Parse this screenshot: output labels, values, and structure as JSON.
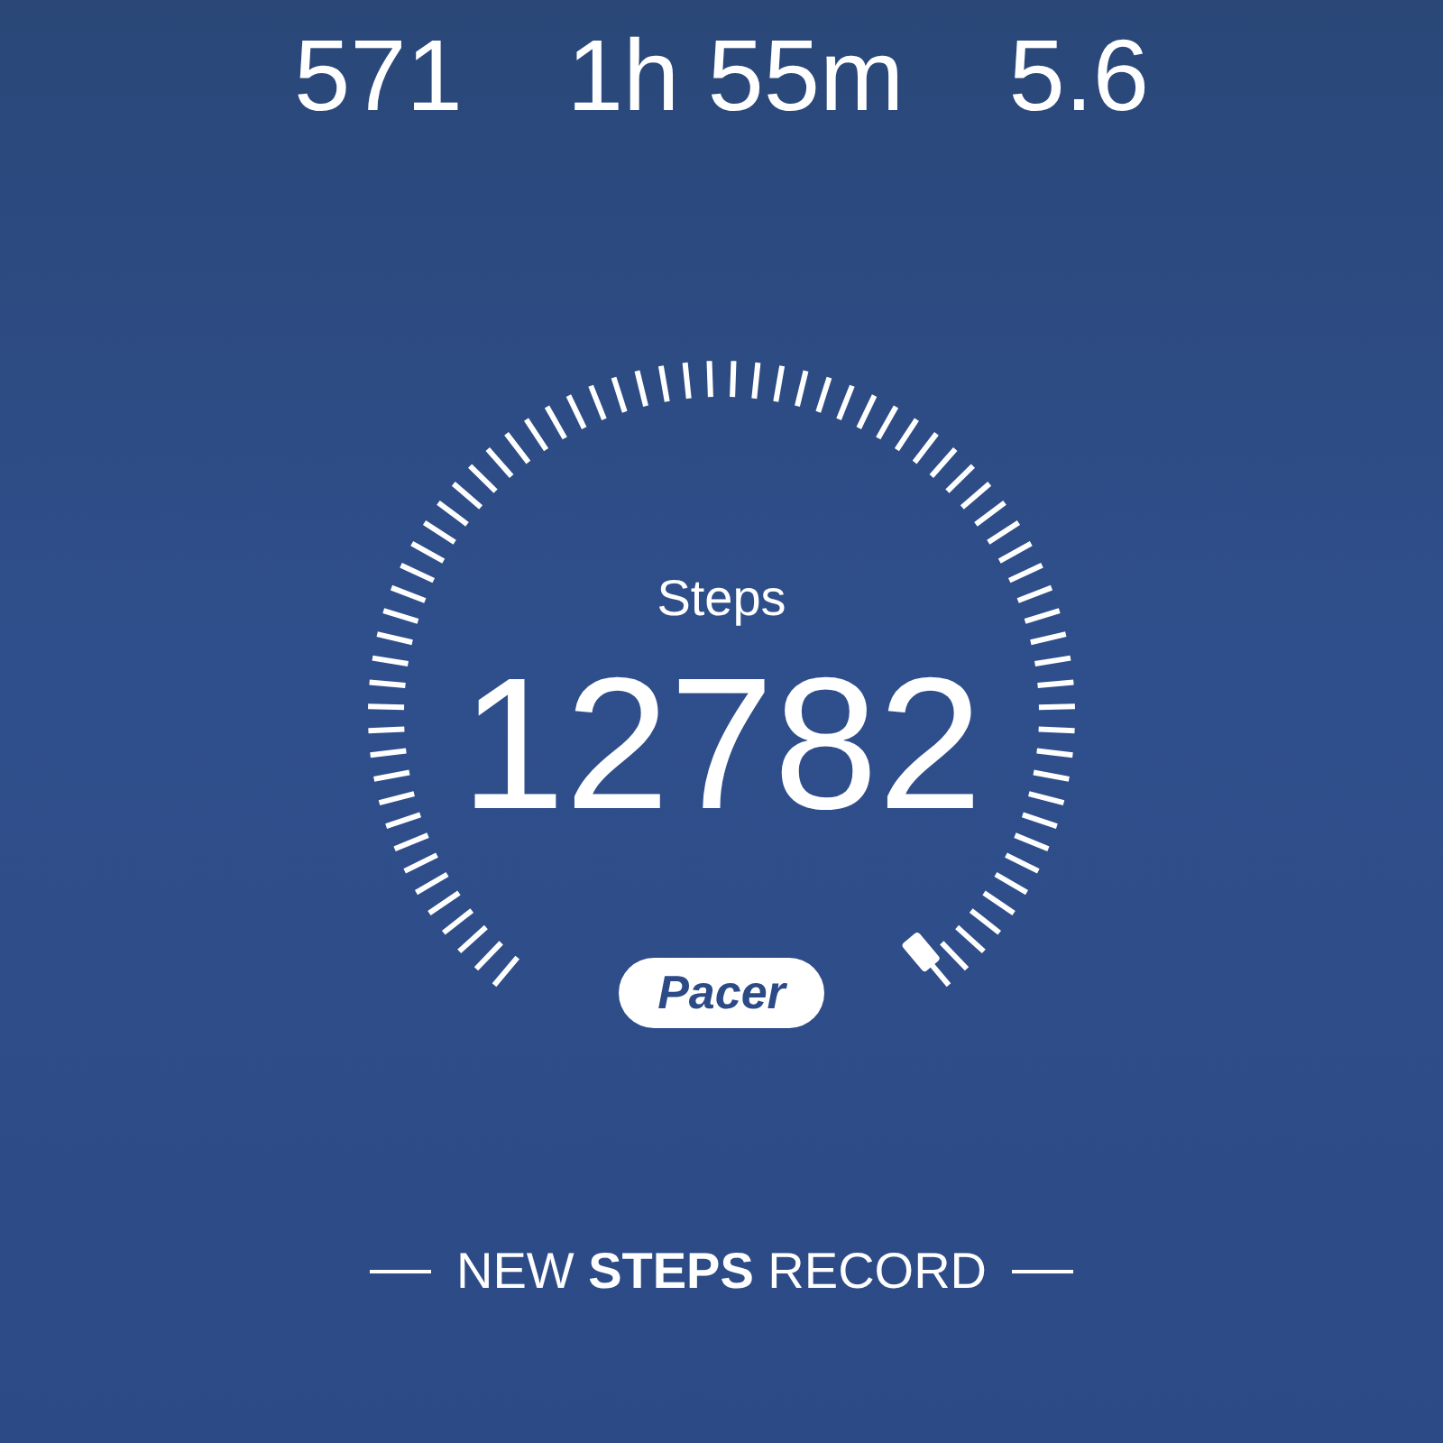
{
  "stats": [
    {
      "value": "571"
    },
    {
      "value": "1h 55m"
    },
    {
      "value": "5.6"
    }
  ],
  "gauge": {
    "label": "Steps",
    "value": "12782"
  },
  "badge": {
    "text": "Pacer"
  },
  "banner": {
    "text": "NEW **STEPS** RECORD"
  }
}
